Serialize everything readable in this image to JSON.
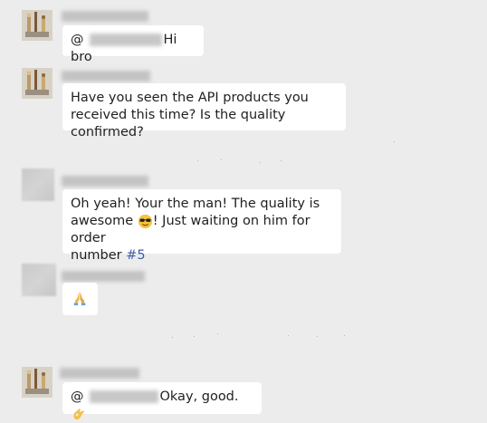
{
  "chat": {
    "messages": [
      {
        "avatar": "figurine-photo-avatar",
        "mention_prefix": "@",
        "text": "Hi bro"
      },
      {
        "avatar": "figurine-photo-avatar",
        "text_line1": "Have you seen the API products you",
        "text_line2": "received this time? Is the quality confirmed?"
      },
      {
        "avatar": "blurred-avatar",
        "text_line1": "Oh yeah! Your the man! The quality is",
        "text_line2_a": "awesome",
        "text_line2_emoji": "sunglasses-face-emoji",
        "text_line2_b": "! Just waiting on him for order",
        "text_line3_a": "number",
        "text_line3_link": "#5"
      },
      {
        "avatar": "blurred-avatar",
        "emoji": "praying-hands-emoji"
      },
      {
        "avatar": "figurine-photo-avatar",
        "mention_prefix": "@",
        "text": "Okay, good.",
        "emoji": "ok-hand-emoji"
      }
    ]
  },
  "colors": {
    "background": "#ececec",
    "bubble": "#ffffff",
    "text": "#1f1f1f",
    "link": "#3d5ea8",
    "blur": "#c3c3c3"
  }
}
